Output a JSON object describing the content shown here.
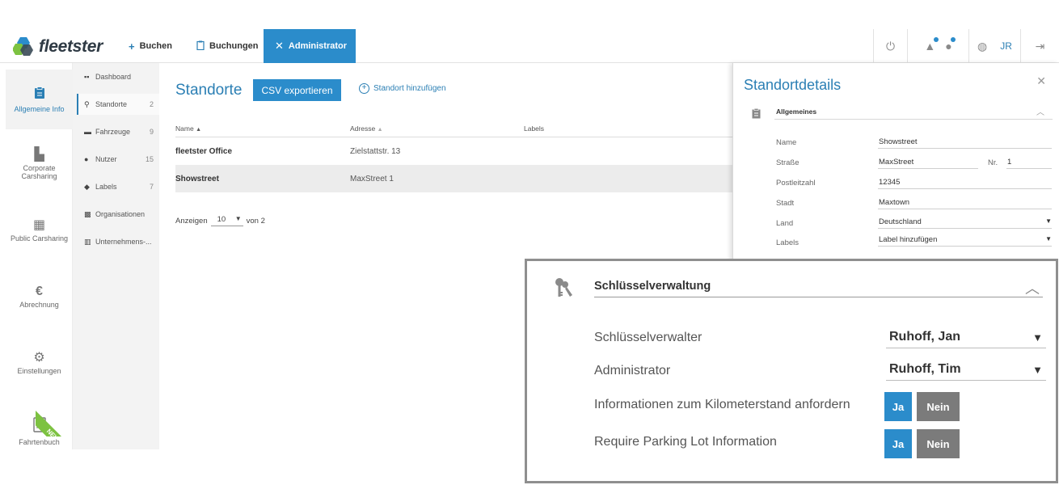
{
  "brand": {
    "name": "fleetster"
  },
  "topnav": {
    "items": [
      {
        "label": "Buchen",
        "icon": "plus-icon"
      },
      {
        "label": "Buchungen",
        "icon": "clipboard-icon"
      },
      {
        "label": "Administrator",
        "icon": "tools-icon",
        "active": true
      }
    ],
    "user_initials": "JR"
  },
  "sidebar": {
    "items": [
      {
        "label": "Allgemeine Info",
        "icon": "clipboard-icon",
        "active": true
      },
      {
        "label": "Corporate Carsharing",
        "icon": "building-icon"
      },
      {
        "label": "Public Carsharing",
        "icon": "building-icon"
      },
      {
        "label": "Abrechnung",
        "icon": "euro-icon"
      },
      {
        "label": "Einstellungen",
        "icon": "gear-icon"
      },
      {
        "label": "Fahrtenbuch",
        "icon": "logbook-icon",
        "badge": "NEW"
      }
    ]
  },
  "subnav": {
    "items": [
      {
        "label": "Dashboard",
        "count": ""
      },
      {
        "label": "Standorte",
        "count": "2",
        "active": true
      },
      {
        "label": "Fahrzeuge",
        "count": "9"
      },
      {
        "label": "Nutzer",
        "count": "15"
      },
      {
        "label": "Labels",
        "count": "7"
      },
      {
        "label": "Organisationen",
        "count": ""
      },
      {
        "label": "Unternehmens-...",
        "count": ""
      }
    ]
  },
  "main": {
    "title": "Standorte",
    "csv_button": "CSV exportieren",
    "add_link": "Standort hinzufügen",
    "columns": [
      "Name",
      "Adresse",
      "Labels"
    ],
    "rows": [
      {
        "name": "fleetster Office",
        "address": "Zielstattstr. 13"
      },
      {
        "name": "Showstreet",
        "address": "MaxStreet 1",
        "selected": true
      }
    ],
    "pager": {
      "show_label": "Anzeigen",
      "page_size": "10",
      "of_label": "von 2"
    }
  },
  "details": {
    "title": "Standortdetails",
    "section_title": "Allgemeines",
    "fields": {
      "name_label": "Name",
      "name_value": "Showstreet",
      "street_label": "Straße",
      "street_value": "MaxStreet",
      "nr_label": "Nr.",
      "nr_value": "1",
      "zip_label": "Postleitzahl",
      "zip_value": "12345",
      "city_label": "Stadt",
      "city_value": "Maxtown",
      "country_label": "Land",
      "country_value": "Deutschland",
      "labels_label": "Labels",
      "labels_value": "Label hinzufügen"
    }
  },
  "zoom": {
    "section_title": "Schlüsselverwaltung",
    "key_manager_label": "Schlüsselverwalter",
    "key_manager_value": "Ruhoff, Jan",
    "admin_label": "Administrator",
    "admin_value": "Ruhoff, Tim",
    "mileage_label": "Informationen zum Kilometerstand anfordern",
    "parking_label": "Require Parking Lot Information",
    "yes_label": "Ja",
    "no_label": "Nein"
  },
  "colors": {
    "accent": "#2b8ccb",
    "new_badge": "#7dc241",
    "no_button": "#7b7b7b"
  }
}
